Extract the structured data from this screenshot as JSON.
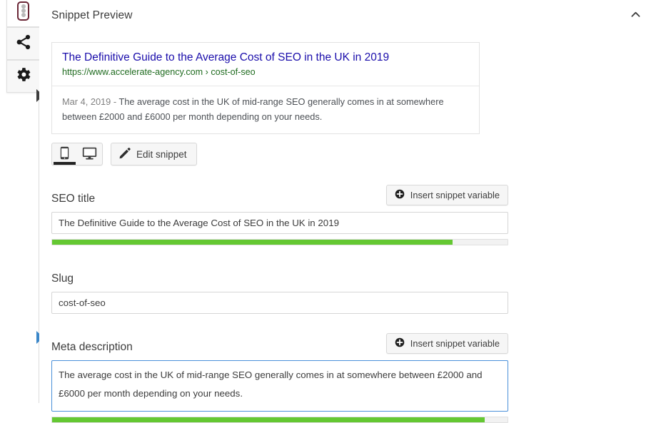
{
  "sidebar": {
    "buttons": [
      {
        "name": "seo-analysis",
        "icon": "traffic-light-icon",
        "active": true
      },
      {
        "name": "social-share",
        "icon": "share-icon",
        "active": false
      },
      {
        "name": "settings",
        "icon": "gear-icon",
        "active": false
      }
    ],
    "markers": [
      {
        "name": "snippet-pointer",
        "color": "#3d3d3d"
      },
      {
        "name": "meta-description-pointer",
        "color": "#3a86c8"
      }
    ]
  },
  "panel": {
    "title": "Snippet Preview",
    "collapse_icon": "chevron-up-icon"
  },
  "snippet_preview": {
    "title": "The Definitive Guide to the Average Cost of SEO in the UK in 2019",
    "url": "https://www.accelerate-agency.com › cost-of-seo",
    "date": "Mar 4, 2019 - ",
    "description": "The average cost in the UK of mid-range SEO generally comes in at somewhere between £2000 and £6000 per month depending on your needs.",
    "title_color": "#1a0dab",
    "url_color": "#1f6b1f"
  },
  "controls": {
    "device_toggle": {
      "mobile_icon": "mobile-phone-icon",
      "desktop_icon": "desktop-monitor-icon",
      "selected": "mobile"
    },
    "edit_snippet": {
      "label": "Edit snippet",
      "icon": "pencil-icon"
    }
  },
  "fields": {
    "seo_title": {
      "label": "SEO title",
      "value": "The Definitive Guide to the Average Cost of SEO in the UK in 2019",
      "placeholder": "",
      "insert_button": {
        "label": "Insert snippet variable",
        "icon": "plus-circle-icon"
      },
      "progress": {
        "percent": 88,
        "color": "#64c832"
      }
    },
    "slug": {
      "label": "Slug",
      "value": "cost-of-seo",
      "placeholder": ""
    },
    "meta_description": {
      "label": "Meta description",
      "value": "The average cost in the UK of mid-range SEO generally comes in at somewhere between £2000 and £6000 per month depending on your needs.",
      "placeholder": "",
      "focused": true,
      "insert_button": {
        "label": "Insert snippet variable",
        "icon": "plus-circle-icon"
      },
      "progress": {
        "percent": 95,
        "color": "#64c832"
      }
    }
  }
}
